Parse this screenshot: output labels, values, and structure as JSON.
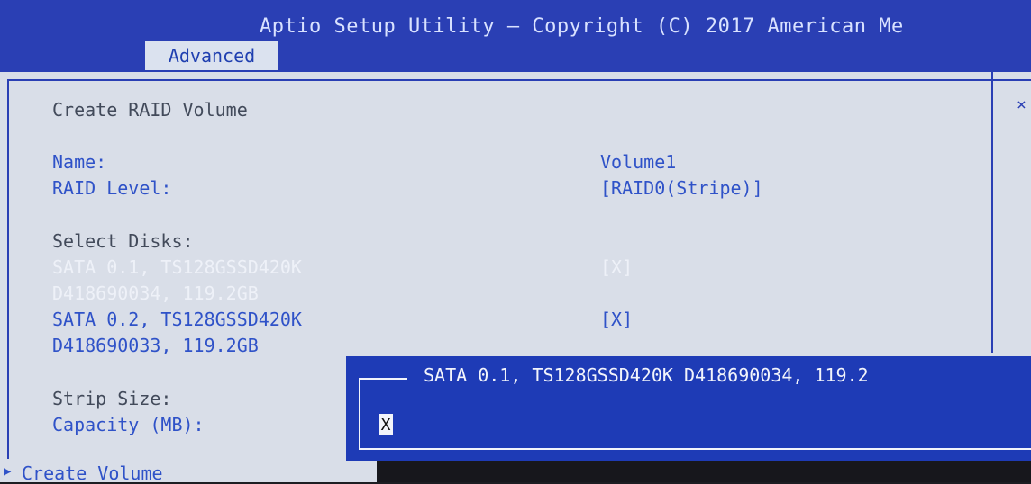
{
  "header": {
    "title": "Aptio Setup Utility – Copyright (C) 2017 American Me",
    "active_tab": "Advanced"
  },
  "page": {
    "heading": "Create RAID Volume",
    "side_mark": "×"
  },
  "fields": {
    "name_label": "Name:",
    "name_value": "Volume1",
    "raid_label": "RAID Level:",
    "raid_value": "[RAID0(Stripe)]",
    "select_disks_label": "Select Disks:",
    "disk1_line1": "SATA 0.1, TS128GSSD420K",
    "disk1_line2": "D418690034, 119.2GB",
    "disk1_value": "[X]",
    "disk2_line1": "SATA 0.2, TS128GSSD420K",
    "disk2_line2": "D418690033, 119.2GB",
    "disk2_value": "[X]",
    "strip_size_label": "Strip Size:",
    "capacity_label": "Capacity (MB):",
    "create_volume_label": "Create Volume"
  },
  "popup": {
    "title": "SATA 0.1, TS128GSSD420K D418690034, 119.2",
    "input_value": "X"
  },
  "icons": {
    "selection_arrow": "▶"
  },
  "colors": {
    "header_blue": "#2a3fb4",
    "panel_bg": "#d9dee8",
    "item_blue": "#2f52c8",
    "popup_blue": "#1e3bb6"
  }
}
